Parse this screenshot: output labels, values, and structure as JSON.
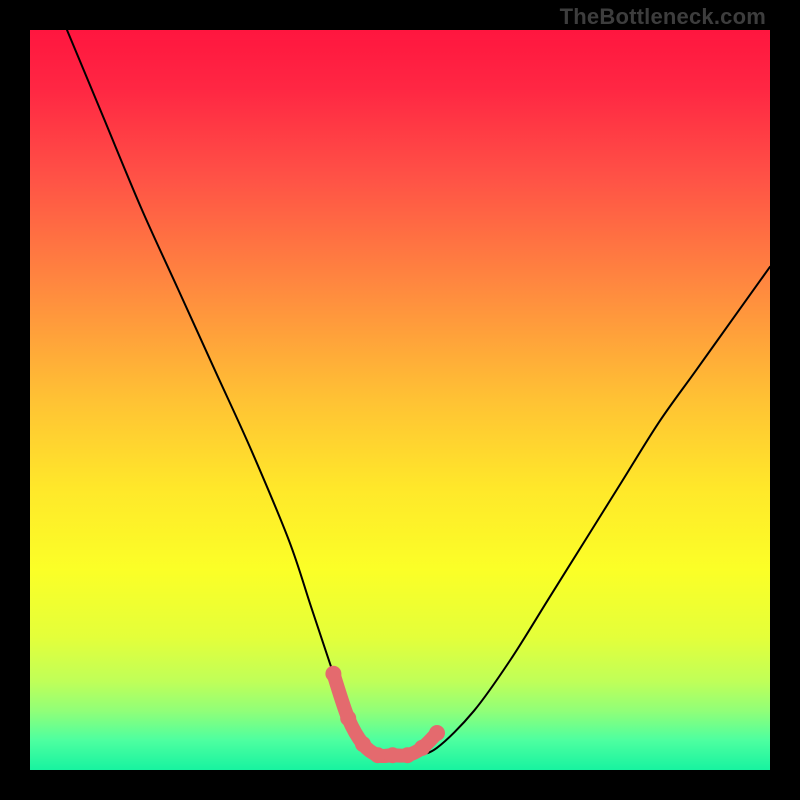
{
  "watermark": "TheBottleneck.com",
  "gradient": {
    "stops": [
      {
        "offset": 0.0,
        "color": "#ff163f"
      },
      {
        "offset": 0.08,
        "color": "#ff2743"
      },
      {
        "offset": 0.2,
        "color": "#ff5246"
      },
      {
        "offset": 0.35,
        "color": "#ff8a3f"
      },
      {
        "offset": 0.5,
        "color": "#ffc234"
      },
      {
        "offset": 0.62,
        "color": "#ffe82a"
      },
      {
        "offset": 0.73,
        "color": "#fbff27"
      },
      {
        "offset": 0.82,
        "color": "#e4ff3a"
      },
      {
        "offset": 0.88,
        "color": "#c0ff58"
      },
      {
        "offset": 0.92,
        "color": "#91ff78"
      },
      {
        "offset": 0.96,
        "color": "#4dffa0"
      },
      {
        "offset": 1.0,
        "color": "#17f3a0"
      }
    ]
  },
  "chart_data": {
    "type": "line",
    "title": "",
    "xlabel": "",
    "ylabel": "",
    "xlim": [
      0,
      100
    ],
    "ylim": [
      0,
      100
    ],
    "grid": false,
    "series": [
      {
        "name": "bottleneck-curve",
        "x": [
          5,
          10,
          15,
          20,
          25,
          30,
          35,
          38,
          41,
          43,
          46,
          49,
          52,
          55,
          60,
          65,
          70,
          75,
          80,
          85,
          90,
          95,
          100
        ],
        "y": [
          100,
          88,
          76,
          65,
          54,
          43,
          31,
          22,
          13,
          7,
          3,
          2,
          2,
          3,
          8,
          15,
          23,
          31,
          39,
          47,
          54,
          61,
          68
        ]
      }
    ],
    "highlight_band": {
      "name": "optimal-range",
      "x": [
        41,
        43,
        45,
        47,
        49,
        51,
        53,
        55
      ],
      "y": [
        13,
        7,
        3.5,
        2,
        2,
        2,
        3,
        5
      ],
      "description": "thick salmon segment near the curve minimum"
    }
  },
  "colors": {
    "curve": "#000000",
    "highlight": "#e46a6e",
    "highlight_dot": "#e46a6e",
    "frame": "#000000",
    "watermark": "#3d3d3d"
  }
}
